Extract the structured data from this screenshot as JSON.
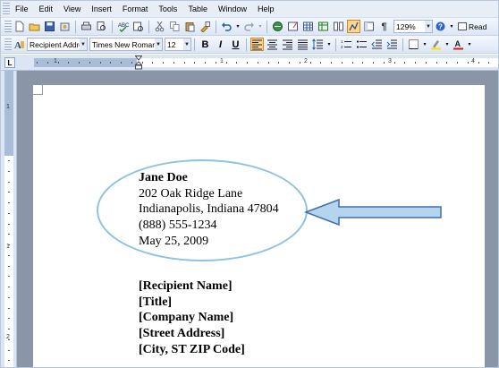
{
  "menu": [
    "File",
    "Edit",
    "View",
    "Insert",
    "Format",
    "Tools",
    "Table",
    "Window",
    "Help"
  ],
  "toolbar": {
    "zoom": "129%",
    "read_label": "Read",
    "style": "Recipient Addre",
    "font": "Times New Roman",
    "size": "12",
    "bold": "B",
    "italic": "I",
    "underline": "U"
  },
  "ruler": {
    "h_numbers": [
      "1",
      "1",
      "2",
      "3",
      "4"
    ],
    "v_numbers": [
      "1",
      "1",
      "2"
    ]
  },
  "document": {
    "sender": [
      "Jane Doe",
      "202 Oak Ridge Lane",
      "Indianapolis, Indiana 47804",
      "(888) 555-1234",
      "May 25, 2009"
    ],
    "recipient": [
      "[Recipient Name]",
      "[Title]",
      "[Company Name]",
      "[Street Address]",
      "[City, ST  ZIP Code]"
    ]
  },
  "colors": {
    "ellipse": "#8ec3e0",
    "arrow_fill": "#b7d4ee",
    "arrow_stroke": "#3f6fb0",
    "active_button": "#ffd38a"
  }
}
